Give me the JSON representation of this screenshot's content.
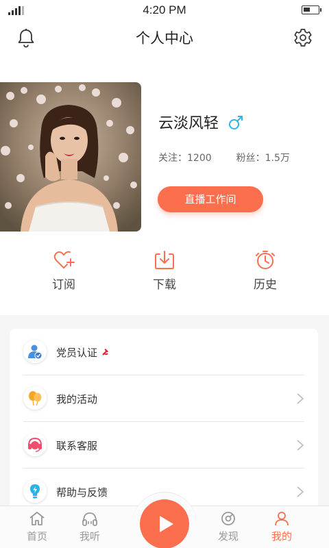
{
  "status_bar": {
    "time": "4:20 PM"
  },
  "header": {
    "title": "个人中心",
    "left_icon": "bell-icon",
    "right_icon": "gear-icon"
  },
  "profile": {
    "nickname": "云淡风轻",
    "gender_icon": "male-icon",
    "following_label": "关注：",
    "following_count": "1200",
    "fans_label": "粉丝：",
    "fans_count": "1.5万",
    "studio_button": "直播工作间"
  },
  "quick_actions": [
    {
      "label": "订阅",
      "icon": "heart-plus-icon"
    },
    {
      "label": "下载",
      "icon": "download-icon"
    },
    {
      "label": "历史",
      "icon": "history-clock-icon"
    }
  ],
  "menu": [
    {
      "label": "党员认证",
      "icon": "party-member-icon",
      "badge_icon": "hammer-sickle-icon"
    },
    {
      "label": "我的活动",
      "icon": "balloon-icon"
    },
    {
      "label": "联系客服",
      "icon": "headset-icon"
    },
    {
      "label": "帮助与反馈",
      "icon": "lightbulb-icon"
    }
  ],
  "tabbar": [
    {
      "label": "首页",
      "icon": "home-icon"
    },
    {
      "label": "我听",
      "icon": "headphones-icon"
    },
    {
      "label": "发现",
      "icon": "discover-icon"
    },
    {
      "label": "我的",
      "icon": "user-icon",
      "active": true
    }
  ],
  "colors": {
    "accent": "#fb6f4f",
    "male": "#29b6e8",
    "background": "#f5f5f5"
  }
}
